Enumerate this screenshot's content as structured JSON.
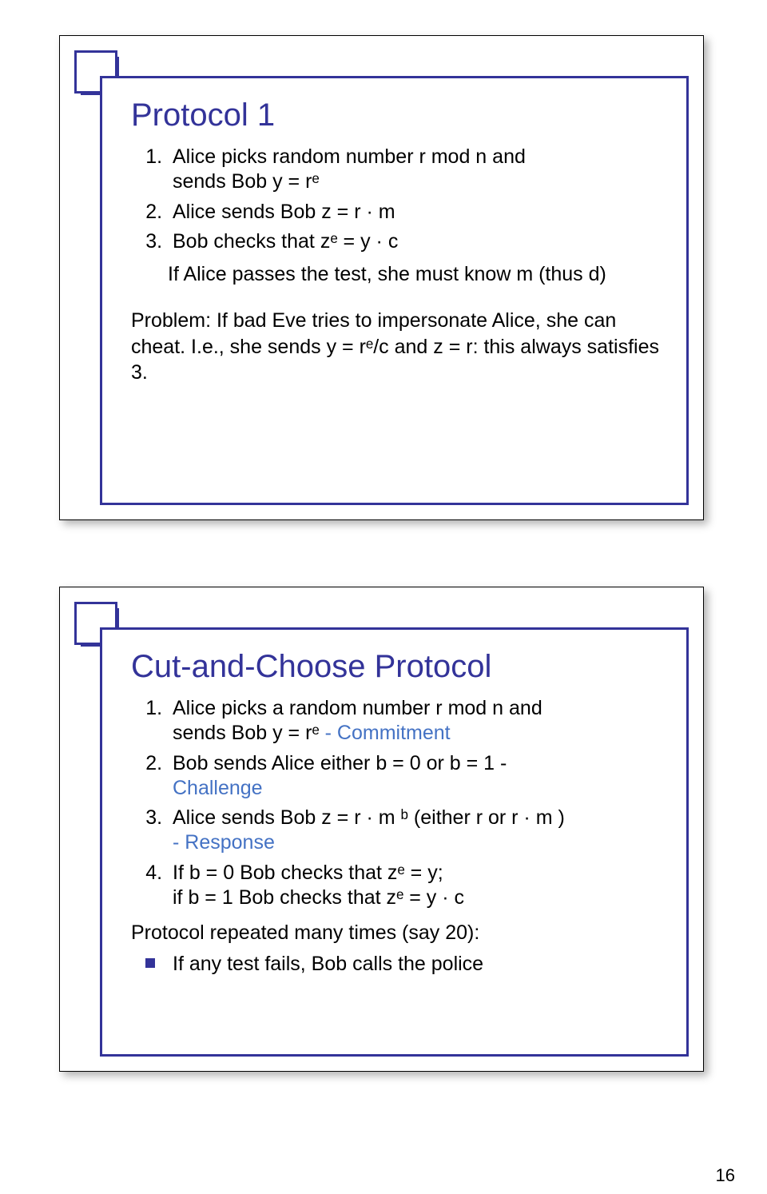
{
  "page_number": "16",
  "slide1": {
    "title": "Protocol 1",
    "item1_a": "Alice picks random number r mod n and",
    "item1_b": "sends Bob y = rᵉ",
    "item2": "Alice sends Bob z = r · m",
    "item3": "Bob checks that zᵉ = y · c",
    "item3_b": "If Alice passes the test, she must know m (thus d)",
    "problem": "Problem: If bad Eve tries to impersonate Alice, she can cheat. I.e., she sends y = rᵉ/c and z = r: this always satisfies 3."
  },
  "slide2": {
    "title": "Cut-and-Choose Protocol",
    "item1_a": "Alice picks a random number r mod n and",
    "item1_b1": "sends Bob y = rᵉ ",
    "item1_b2": "- Commitment",
    "item2_a": "Bob sends Alice either b = 0 or b = 1 -",
    "item2_b": "Challenge",
    "item3_a": "Alice sends Bob z = r · m ᵇ (either r or r · m )",
    "item3_b": "- Response",
    "item4_a": "If b = 0 Bob checks that zᵉ = y;",
    "item4_b": "if b = 1 Bob checks that zᵉ = y · c",
    "footer": "Protocol repeated many times (say 20):",
    "bullet": "If any test fails, Bob calls the police"
  }
}
